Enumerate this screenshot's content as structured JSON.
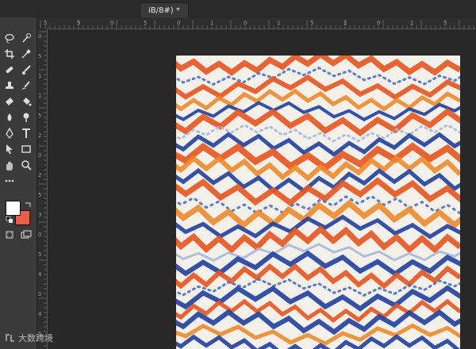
{
  "document": {
    "tab_label": "iB/8#) *",
    "background_color": "#282828"
  },
  "toolbar": {
    "tools": [
      "lasso-icon",
      "quick-select-icon",
      "crop-icon",
      "eyedropper-icon",
      "healing-icon",
      "brush-icon",
      "clone-stamp-icon",
      "history-brush-icon",
      "eraser-icon",
      "paint-bucket-icon",
      "blur-icon",
      "dodge-icon",
      "pen-icon",
      "type-icon",
      "path-select-icon",
      "rectangle-icon",
      "hand-icon",
      "zoom-icon",
      "more-icon"
    ],
    "foreground_color": "#ffffff",
    "background_color": "#e8604c"
  },
  "ruler": {
    "top_labels": [
      "5",
      "5",
      "0",
      "5",
      "0",
      "1",
      "0",
      "1",
      "5",
      "2",
      "0",
      "2",
      "5"
    ],
    "left_labels": [
      "0",
      "5",
      "1",
      "1",
      "5",
      "2",
      "0",
      "2",
      "5",
      "3",
      "0",
      "5",
      "4",
      "0",
      "4",
      "5"
    ]
  },
  "artwork": {
    "name": "zigzag-watercolor-pattern",
    "colors": [
      "#e9541f",
      "#f08a2c",
      "#1f3f9e",
      "#4a6fc4",
      "#a9b8dc",
      "#f4f0ea"
    ]
  },
  "watermark": {
    "text": "大数跨境"
  }
}
